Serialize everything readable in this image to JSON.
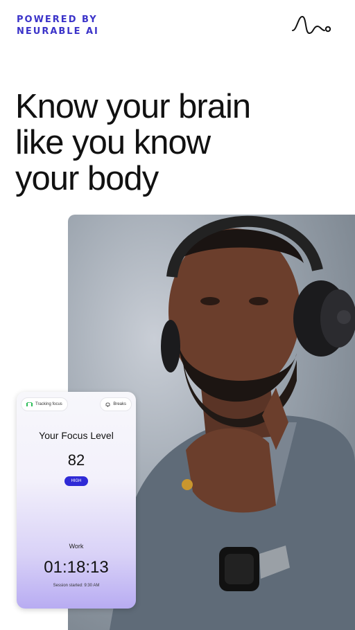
{
  "brand": {
    "line1": "POWERED BY",
    "line2": "NEURABLE AI",
    "color": "#3b33c9"
  },
  "logo": {
    "icon": "neurable-wave-logo-icon"
  },
  "headline": {
    "line1": "Know your brain",
    "line2": "like you know",
    "line3": "your body"
  },
  "photo": {
    "description_icon": "person-with-headphones-photo"
  },
  "focus_card": {
    "tracking_label": "Tracking focus",
    "breaks_label": "Breaks",
    "title": "Your Focus Level",
    "score": "82",
    "level": "HIGH",
    "mode": "Work",
    "timer": "01:18:13",
    "session": "Session started: 9:30 AM",
    "accent": "#2f2ad6"
  }
}
